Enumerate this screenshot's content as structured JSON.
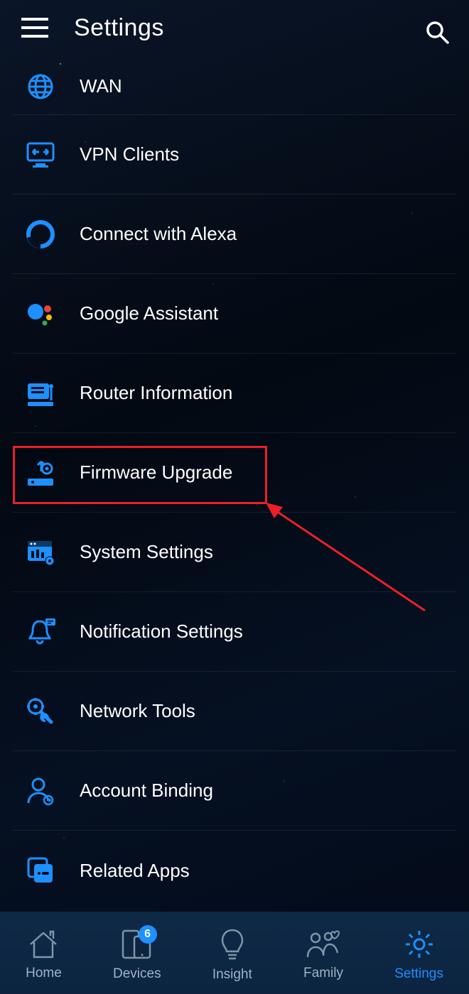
{
  "header": {
    "title": "Settings"
  },
  "items": [
    {
      "key": "wan",
      "label": "WAN"
    },
    {
      "key": "vpn",
      "label": "VPN Clients"
    },
    {
      "key": "alexa",
      "label": "Connect with Alexa"
    },
    {
      "key": "google",
      "label": "Google Assistant"
    },
    {
      "key": "routerinfo",
      "label": "Router Information"
    },
    {
      "key": "firmware",
      "label": "Firmware Upgrade"
    },
    {
      "key": "system",
      "label": "System Settings"
    },
    {
      "key": "notification",
      "label": "Notification Settings"
    },
    {
      "key": "nettools",
      "label": "Network Tools"
    },
    {
      "key": "account",
      "label": "Account Binding"
    },
    {
      "key": "related",
      "label": "Related Apps"
    }
  ],
  "tabs": {
    "home": {
      "label": "Home"
    },
    "devices": {
      "label": "Devices",
      "badge": "6"
    },
    "insight": {
      "label": "Insight"
    },
    "family": {
      "label": "Family"
    },
    "settings": {
      "label": "Settings"
    }
  },
  "annotation": {
    "highlighted_item": "firmware"
  },
  "colors": {
    "accent": "#1e90ff",
    "highlight": "#ec1f27"
  }
}
